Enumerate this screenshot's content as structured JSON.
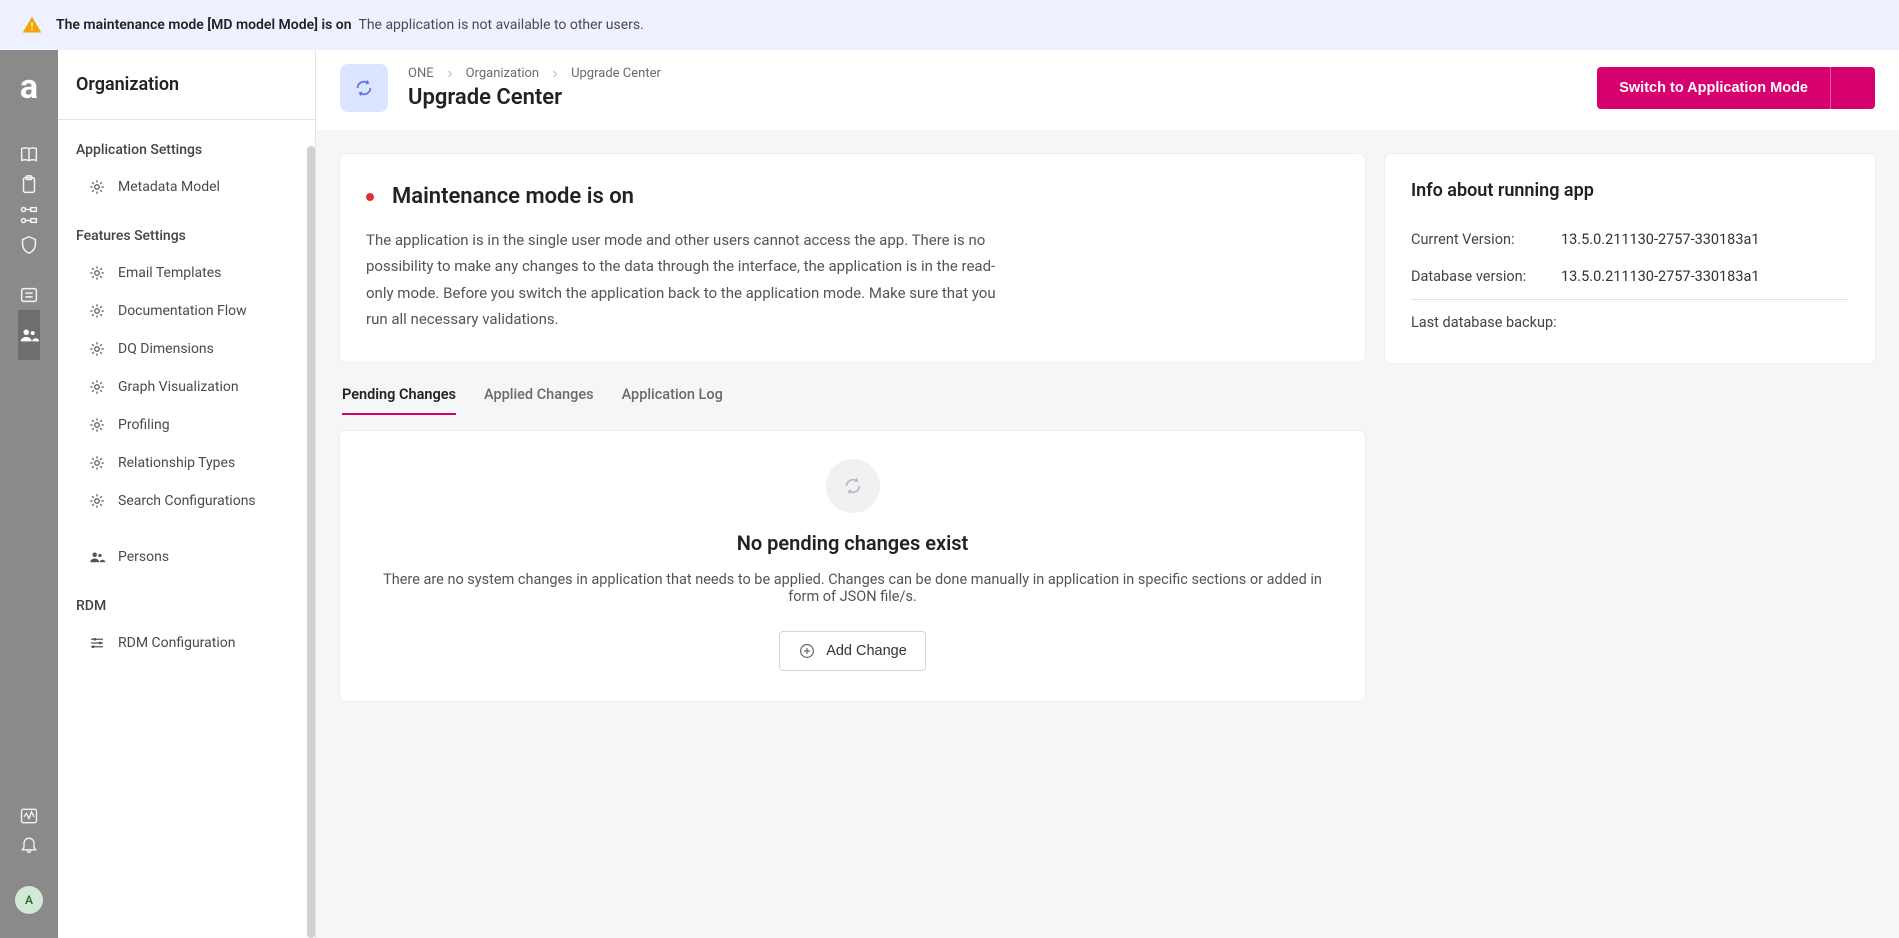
{
  "banner": {
    "strong": "The maintenance mode [MD model Mode] is on",
    "message": "The application is not available to other users."
  },
  "brand_letter": "a",
  "rail": {
    "items": [
      {
        "name": "book"
      },
      {
        "name": "clipboard"
      },
      {
        "name": "nodes"
      },
      {
        "name": "shield"
      },
      {
        "name": "list",
        "divider": true
      },
      {
        "name": "people",
        "active": true
      }
    ],
    "bottom": [
      {
        "name": "activity"
      },
      {
        "name": "bell"
      }
    ],
    "avatar_letter": "A"
  },
  "sidebar": {
    "title": "Organization",
    "groups": [
      {
        "label": "Application Settings",
        "items": [
          {
            "label": "Metadata Model",
            "icon": "gear"
          }
        ]
      },
      {
        "label": "Features Settings",
        "items": [
          {
            "label": "Email Templates",
            "icon": "gear"
          },
          {
            "label": "Documentation Flow",
            "icon": "gear"
          },
          {
            "label": "DQ Dimensions",
            "icon": "gear"
          },
          {
            "label": "Graph Visualization",
            "icon": "gear"
          },
          {
            "label": "Profiling",
            "icon": "gear"
          },
          {
            "label": "Relationship Types",
            "icon": "gear"
          },
          {
            "label": "Search Configurations",
            "icon": "gear"
          }
        ]
      },
      {
        "gap_before": true,
        "items": [
          {
            "label": "Persons",
            "icon": "people"
          }
        ]
      },
      {
        "label": "RDM",
        "items": [
          {
            "label": "RDM Configuration",
            "icon": "sliders"
          }
        ]
      }
    ]
  },
  "header": {
    "crumbs": [
      "ONE",
      "Organization",
      "Upgrade Center"
    ],
    "title": "Upgrade Center",
    "switch_label": "Switch to Application Mode"
  },
  "notice": {
    "title": "Maintenance mode is on",
    "body": "The application is in the single user mode and other users cannot access the app. There is no possi­bility to make any changes to the data through the interface, the application is in the read-only mode. Before you switch the application back to the application mode. Make sure that you run all necessary validations."
  },
  "info": {
    "title": "Info about running app",
    "rows": [
      {
        "k": "Current Version:",
        "v": "13.5.0.211130-2757-330183a1"
      },
      {
        "k": "Database version:",
        "v": "13.5.0.211130-2757-330183a1"
      }
    ],
    "last_backup_label": "Last database backup:",
    "last_backup_value": ""
  },
  "tabs": [
    {
      "label": "Pending Changes",
      "active": true
    },
    {
      "label": "Applied Changes"
    },
    {
      "label": "Application Log"
    }
  ],
  "empty": {
    "title": "No pending changes exist",
    "body": "There are no system changes in application that needs to be applied. Changes can be done manually in application in specific sections or added in form of JSON file/s.",
    "add_label": "Add Change"
  }
}
